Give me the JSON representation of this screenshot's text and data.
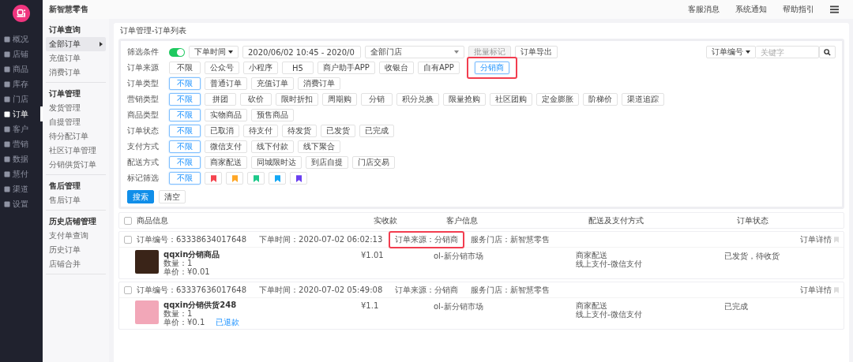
{
  "app_title": "新智慧零售",
  "top_links": [
    "客服消息",
    "系统通知",
    "帮助指引"
  ],
  "nav": [
    {
      "label": "概况",
      "selected": false
    },
    {
      "label": "店铺",
      "selected": false
    },
    {
      "label": "商品",
      "selected": false
    },
    {
      "label": "库存",
      "selected": false
    },
    {
      "label": "门店",
      "selected": false
    },
    {
      "label": "订单",
      "selected": true
    },
    {
      "label": "客户",
      "selected": false
    },
    {
      "label": "营销",
      "selected": false
    },
    {
      "label": "数据",
      "selected": false
    },
    {
      "label": "慧付",
      "selected": false
    },
    {
      "label": "渠道",
      "selected": false
    },
    {
      "label": "设置",
      "selected": false
    }
  ],
  "subnav": [
    {
      "heading": "订单查询",
      "items": [
        {
          "label": "全部订单",
          "selected": true
        },
        {
          "label": "充值订单",
          "selected": false
        },
        {
          "label": "消费订单",
          "selected": false
        }
      ]
    },
    {
      "heading": "订单管理",
      "items": [
        {
          "label": "发货管理",
          "selected": false
        },
        {
          "label": "自提管理",
          "selected": false
        },
        {
          "label": "待分配订单",
          "selected": false
        },
        {
          "label": "社区订单管理",
          "selected": false
        },
        {
          "label": "分销供货订单",
          "selected": false
        }
      ]
    },
    {
      "heading": "售后管理",
      "items": [
        {
          "label": "售后订单",
          "selected": false
        }
      ]
    },
    {
      "heading": "历史店铺管理",
      "items": [
        {
          "label": "支付单查询",
          "selected": false
        },
        {
          "label": "历史订单",
          "selected": false
        },
        {
          "label": "店铺合并",
          "selected": false
        }
      ]
    }
  ],
  "breadcrumb": "订单管理-订单列表",
  "filter": {
    "label": "筛选条件",
    "toggle_on": true,
    "time_type": "下单时间",
    "date_range": "2020/06/02 10:45 - 2020/0",
    "store": "全部门店",
    "buttons": [
      {
        "label": "批量标记",
        "disabled": true
      },
      {
        "label": "订单导出",
        "disabled": false
      }
    ],
    "search_type": "订单编号",
    "search_placeholder": "关键字"
  },
  "filter_rows": [
    {
      "label": "订单来源",
      "options": [
        {
          "label": "不限",
          "selected": false,
          "annotated": false
        },
        {
          "label": "公众号",
          "selected": false,
          "annotated": false
        },
        {
          "label": "小程序",
          "selected": false,
          "annotated": false
        },
        {
          "label": "H5",
          "selected": false,
          "annotated": false
        },
        {
          "label": "商户助手APP",
          "selected": false,
          "annotated": false
        },
        {
          "label": "收银台",
          "selected": false,
          "annotated": false
        },
        {
          "label": "自有APP",
          "selected": false,
          "annotated": false
        },
        {
          "label": "分销商",
          "selected": true,
          "annotated": true
        }
      ]
    },
    {
      "label": "订单类型",
      "options": [
        {
          "label": "不限",
          "selected": true,
          "annotated": false
        },
        {
          "label": "普通订单",
          "selected": false,
          "annotated": false
        },
        {
          "label": "充值订单",
          "selected": false,
          "annotated": false
        },
        {
          "label": "消费订单",
          "selected": false,
          "annotated": false
        }
      ]
    },
    {
      "label": "营销类型",
      "options": [
        {
          "label": "不限",
          "selected": true,
          "annotated": false
        },
        {
          "label": "拼团",
          "selected": false,
          "annotated": false
        },
        {
          "label": "砍价",
          "selected": false,
          "annotated": false
        },
        {
          "label": "限时折扣",
          "selected": false,
          "annotated": false
        },
        {
          "label": "周期购",
          "selected": false,
          "annotated": false
        },
        {
          "label": "分销",
          "selected": false,
          "annotated": false
        },
        {
          "label": "积分兑换",
          "selected": false,
          "annotated": false
        },
        {
          "label": "限量抢购",
          "selected": false,
          "annotated": false
        },
        {
          "label": "社区团购",
          "selected": false,
          "annotated": false
        },
        {
          "label": "定金膨胀",
          "selected": false,
          "annotated": false
        },
        {
          "label": "阶梯价",
          "selected": false,
          "annotated": false
        },
        {
          "label": "渠道追踪",
          "selected": false,
          "annotated": false
        }
      ]
    },
    {
      "label": "商品类型",
      "options": [
        {
          "label": "不限",
          "selected": true,
          "annotated": false
        },
        {
          "label": "实物商品",
          "selected": false,
          "annotated": false
        },
        {
          "label": "预售商品",
          "selected": false,
          "annotated": false
        }
      ]
    },
    {
      "label": "订单状态",
      "options": [
        {
          "label": "不限",
          "selected": true,
          "annotated": false
        },
        {
          "label": "已取消",
          "selected": false,
          "annotated": false
        },
        {
          "label": "待支付",
          "selected": false,
          "annotated": false
        },
        {
          "label": "待发货",
          "selected": false,
          "annotated": false
        },
        {
          "label": "已发货",
          "selected": false,
          "annotated": false
        },
        {
          "label": "已完成",
          "selected": false,
          "annotated": false
        }
      ]
    },
    {
      "label": "支付方式",
      "options": [
        {
          "label": "不限",
          "selected": true,
          "annotated": false
        },
        {
          "label": "微信支付",
          "selected": false,
          "annotated": false
        },
        {
          "label": "线下付款",
          "selected": false,
          "annotated": false
        },
        {
          "label": "线下聚合",
          "selected": false,
          "annotated": false
        }
      ]
    },
    {
      "label": "配送方式",
      "options": [
        {
          "label": "不限",
          "selected": true,
          "annotated": false
        },
        {
          "label": "商家配送",
          "selected": false,
          "annotated": false
        },
        {
          "label": "同城限时达",
          "selected": false,
          "annotated": false
        },
        {
          "label": "到店自提",
          "selected": false,
          "annotated": false
        },
        {
          "label": "门店交易",
          "selected": false,
          "annotated": false
        }
      ]
    },
    {
      "label": "标记筛选",
      "options": [
        {
          "kind": "text",
          "label": "不限",
          "selected": true,
          "annotated": false
        },
        {
          "kind": "flag",
          "color": "#f5454f",
          "selected": false,
          "annotated": false
        },
        {
          "kind": "flag",
          "color": "#ffa726",
          "selected": false,
          "annotated": false
        },
        {
          "kind": "flag",
          "color": "#1ec98a",
          "selected": false,
          "annotated": false
        },
        {
          "kind": "flag",
          "color": "#13a8f5",
          "selected": false,
          "annotated": false
        },
        {
          "kind": "flag",
          "color": "#6a3ff0",
          "selected": false,
          "annotated": false
        }
      ]
    }
  ],
  "actions": [
    {
      "label": "搜索",
      "primary": true
    },
    {
      "label": "清空",
      "primary": false
    }
  ],
  "table": {
    "select_all": false,
    "columns": [
      "商品信息",
      "实收款",
      "客户信息",
      "配送及支付方式",
      "订单状态"
    ]
  },
  "orders": [
    {
      "checked": false,
      "order_no": "订单编号：63338634017648",
      "time": "下单时间：2020-07-02 06:02:13",
      "source": "订单来源：分销商",
      "source_annotated": true,
      "store": "服务门店：新智慧零售",
      "detail_link": "订单详情",
      "product": {
        "name": "qqxin分销商品",
        "qty": "数量：1",
        "price": "单价：¥0.01"
      },
      "amount": "¥1.01",
      "customer": "ol-新分销市场",
      "delivery": "商家配送",
      "payment": "线上支付-微信支付",
      "status": "已发货，待收货"
    },
    {
      "checked": false,
      "order_no": "订单编号：63337636017648",
      "time": "下单时间：2020-07-02 05:49:08",
      "source": "订单来源：分销商",
      "source_annotated": false,
      "store": "服务门店：新智慧零售",
      "detail_link": "订单详情",
      "product": {
        "name": "qqxin分销供货248",
        "qty": "数量：1",
        "price": "单价：¥0.1",
        "refund": "已退款"
      },
      "amount": "¥1.1",
      "customer": "ol-新分销市场",
      "delivery": "商家配送",
      "payment": "线上支付-微信支付",
      "status": "已完成"
    }
  ]
}
